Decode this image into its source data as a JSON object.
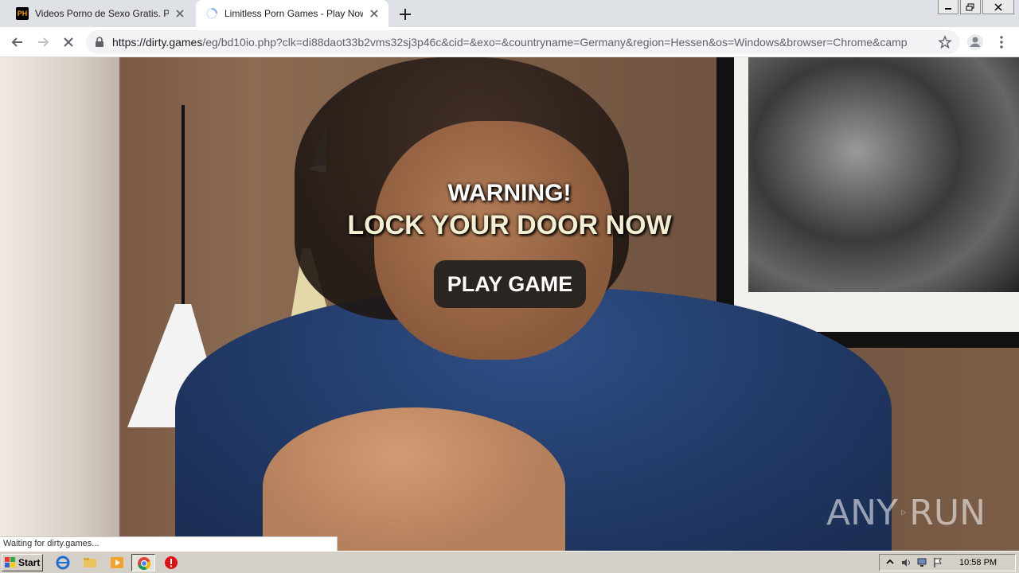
{
  "browser": {
    "tabs": [
      {
        "title": "Videos Porno de Sexo Gratis. Pelicula",
        "favicon": "PH",
        "active": false
      },
      {
        "title": "Limitless Porn Games - Play Now",
        "active": true,
        "loading": true
      }
    ],
    "url_host": "https://dirty.games",
    "url_rest": "/eg/bd10io.php?clk=di88daot33b2vms32sj3p46c&cid=&exo=&countryname=Germany&region=Hessen&os=Windows&browser=Chrome&camp..."
  },
  "page": {
    "warning_line1": "WARNING!",
    "warning_line2": "LOCK YOUR DOOR NOW",
    "play_button": "PLAY GAME",
    "watermark_left": "ANY",
    "watermark_right": "RUN"
  },
  "status_bar": "Waiting for dirty.games...",
  "taskbar": {
    "start_label": "Start",
    "clock": "10:58 PM"
  },
  "colors": {
    "tabstrip": "#dee1e6",
    "button_bg": "#2a2520",
    "taskbar": "#d4d0c8"
  }
}
